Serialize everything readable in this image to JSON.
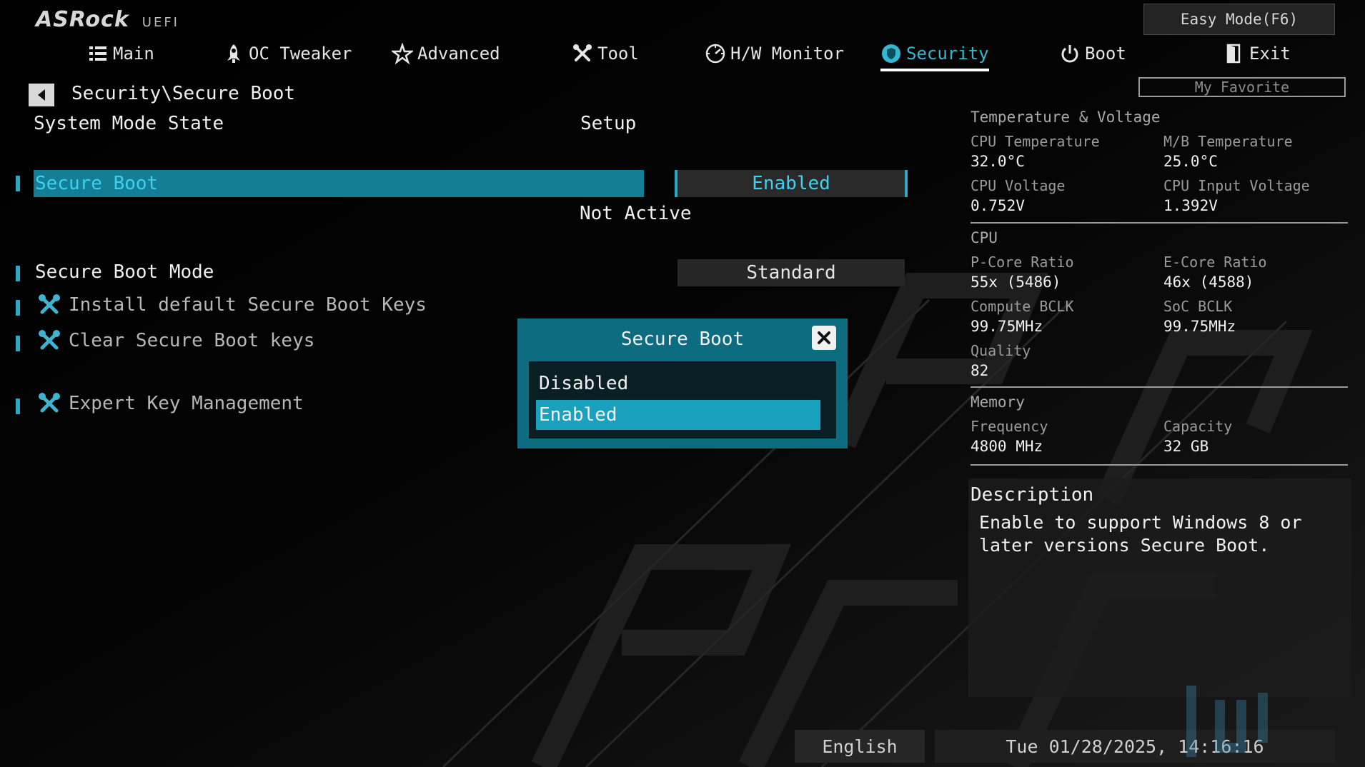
{
  "header": {
    "brand": "ASRock",
    "product": "UEFI",
    "easy_mode": "Easy Mode(F6)",
    "my_favorite": "My Favorite"
  },
  "tabs": [
    {
      "label": "Main",
      "icon": "list-icon"
    },
    {
      "label": "OC Tweaker",
      "icon": "rocket-icon"
    },
    {
      "label": "Advanced",
      "icon": "star-icon"
    },
    {
      "label": "Tool",
      "icon": "tools-icon"
    },
    {
      "label": "H/W Monitor",
      "icon": "gauge-icon"
    },
    {
      "label": "Security",
      "icon": "shield-icon",
      "active": true
    },
    {
      "label": "Boot",
      "icon": "power-icon"
    },
    {
      "label": "Exit",
      "icon": "exit-icon"
    }
  ],
  "main": {
    "breadcrumb": "Security\\Secure Boot",
    "system_mode_label": "System Mode State",
    "system_mode_value": "Setup",
    "secure_boot_label": "Secure Boot",
    "secure_boot_value": "Enabled",
    "secure_boot_status": "Not Active",
    "secure_boot_mode_label": "Secure Boot Mode",
    "secure_boot_mode_value": "Standard",
    "install_keys": "Install default Secure Boot Keys",
    "clear_keys": "Clear Secure Boot keys",
    "expert_keys": "Expert Key Management"
  },
  "popup": {
    "title": "Secure Boot",
    "options": [
      "Disabled",
      "Enabled"
    ],
    "selected": "Enabled"
  },
  "right_panel": {
    "temp_section": "Temperature & Voltage",
    "cpu_temp_label": "CPU Temperature",
    "cpu_temp_value": "32.0°C",
    "mb_temp_label": "M/B Temperature",
    "mb_temp_value": "25.0°C",
    "cpu_volt_label": "CPU Voltage",
    "cpu_volt_value": "0.752V",
    "cpu_in_volt_label": "CPU Input Voltage",
    "cpu_in_volt_value": "1.392V",
    "cpu_section": "CPU",
    "pcore_label": "P-Core Ratio",
    "pcore_value": "55x (5486)",
    "ecore_label": "E-Core Ratio",
    "ecore_value": "46x (4588)",
    "bclk_label": "Compute BCLK",
    "bclk_value": "99.75MHz",
    "soc_label": "SoC BCLK",
    "soc_value": "99.75MHz",
    "quality_label": "Quality",
    "quality_value": "82",
    "memory_section": "Memory",
    "freq_label": "Frequency",
    "freq_value": "4800 MHz",
    "cap_label": "Capacity",
    "cap_value": "32 GB",
    "desc_title": "Description",
    "desc_text": "Enable to support Windows 8 or later versions Secure Boot."
  },
  "footer": {
    "language": "English",
    "datetime": "Tue 01/28/2025, 14:16:16"
  },
  "colors": {
    "accent": "#2aa8c6",
    "highlight_row": "#147e96",
    "popup_bg": "#0e6c80"
  }
}
